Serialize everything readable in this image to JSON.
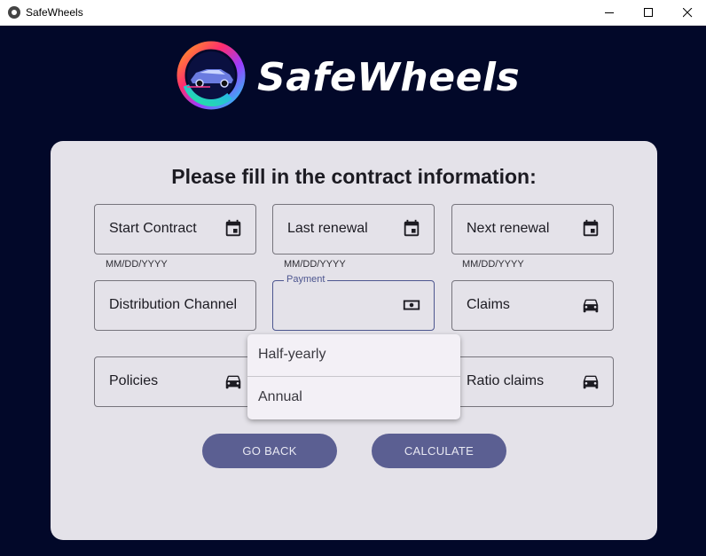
{
  "window": {
    "title": "SafeWheels",
    "app_icon": "app-logo-icon",
    "controls": [
      "minimize-icon",
      "maximize-icon",
      "close-icon"
    ]
  },
  "brand": {
    "name": "SafeWheels",
    "logo_icon": "car-ring-logo"
  },
  "form": {
    "heading": "Please fill in the contract information:",
    "fields": [
      {
        "label": "Start Contract",
        "icon": "calendar-icon",
        "helper": "MM/DD/YYYY"
      },
      {
        "label": "Last renewal",
        "icon": "calendar-icon",
        "helper": "MM/DD/YYYY"
      },
      {
        "label": "Next renewal",
        "icon": "calendar-icon",
        "helper": "MM/DD/YYYY"
      },
      {
        "label": "Distribution Channel",
        "icon": ""
      },
      {
        "label": "Payment",
        "icon": "cash-icon",
        "value": ""
      },
      {
        "label": "Claims",
        "icon": "car-icon"
      },
      {
        "label": "Policies",
        "icon": "car-icon"
      },
      {
        "label": "Ratio claims",
        "icon": "car-icon"
      }
    ],
    "payment_options": [
      "Half-yearly",
      "Annual"
    ],
    "buttons": {
      "back": "GO BACK",
      "calculate": "CALCULATE"
    }
  },
  "colors": {
    "background": "#020829",
    "card": "#e4e2e9",
    "button": "#5b5f92",
    "focus": "#4d568f"
  }
}
